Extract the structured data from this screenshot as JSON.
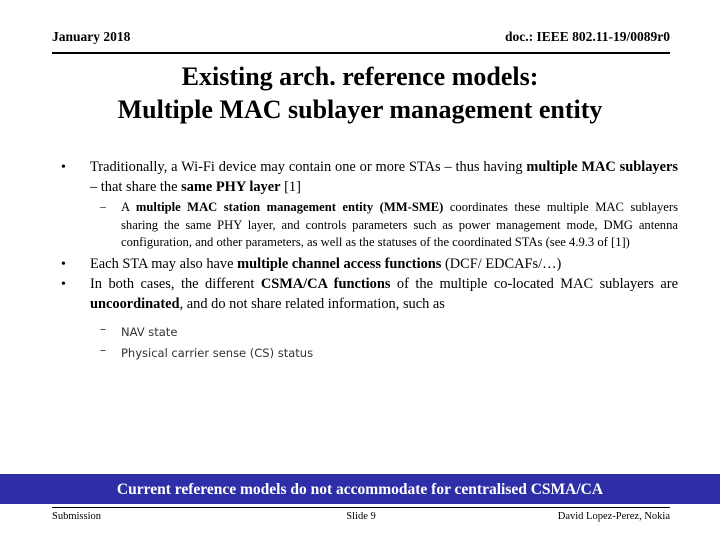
{
  "header": {
    "date": "January 2018",
    "doc": "doc.: IEEE 802.11-19/0089r0"
  },
  "title": {
    "line1": "Existing arch. reference models:",
    "line2": "Multiple MAC sublayer management entity"
  },
  "bullets": {
    "b1_marker": "•",
    "b1_p1": "Traditionally, a Wi-Fi device may contain one or more STAs – thus having ",
    "b1_b1": "multiple MAC sublayers",
    "b1_p2": " – that share the ",
    "b1_b2": "same PHY layer",
    "b1_p3": " [1]",
    "s1_marker": "–",
    "s1_p1": "A ",
    "s1_b1": "multiple MAC station management entity (MM-SME)",
    "s1_p2": " coordinates these multiple MAC sublayers sharing the same PHY layer, and controls parameters such as power management mode, DMG antenna configuration, and other parameters, as well as the statuses of the coordinated STAs (see 4.9.3 of [1])",
    "b2_marker": "•",
    "b2_p1": "Each STA may also have ",
    "b2_b1": "multiple channel access functions",
    "b2_p2": " (DCF/ EDCAFs/…)",
    "b3_marker": "•",
    "b3_p1": "In both cases, the different ",
    "b3_b1": "CSMA/CA functions",
    "b3_p2": " of the multiple co-located MAC sublayers are ",
    "b3_b2": "uncoordinated",
    "b3_p3": ", and do not share related information, such as",
    "s2_marker": "–",
    "s2_text": "NAV state",
    "s3_marker": "–",
    "s3_text": "Physical carrier sense (CS) status"
  },
  "banner": {
    "text": "Current reference models do not accommodate for centralised CSMA/CA",
    "background": "#2E2EA8",
    "color": "#FFFFFF"
  },
  "footer": {
    "left": "Submission",
    "center": "Slide 9",
    "right": "David Lopez-Perez, Nokia"
  }
}
